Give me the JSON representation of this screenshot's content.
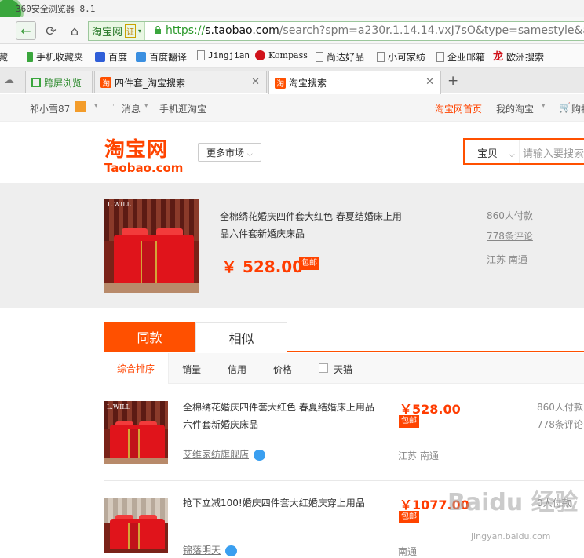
{
  "browser": {
    "title": "360安全浏览器 8.1",
    "site_badge": "淘宝网",
    "cert_label": "证",
    "url_scheme": "https://",
    "url_host": "s.taobao.com",
    "url_path": "/search?spm=a230r.1.14.14.vxJ7sO&type=samestyle&app="
  },
  "bookmarks": [
    {
      "label": "藏",
      "icon": "star-icon"
    },
    {
      "label": "手机收藏夹",
      "icon": "phone-icon"
    },
    {
      "label": "百度",
      "icon": "baidu-paw-icon"
    },
    {
      "label": "百度翻译",
      "icon": "translate-icon"
    },
    {
      "label": "Jingjian",
      "icon": "page-icon"
    },
    {
      "label": "Kompass",
      "icon": "kompass-icon"
    },
    {
      "label": "尚达好品",
      "icon": "page-icon"
    },
    {
      "label": "小可家纺",
      "icon": "page-icon"
    },
    {
      "label": "企业邮箱",
      "icon": "page-icon"
    },
    {
      "label": "欧洲搜索",
      "icon": "dragon-icon"
    }
  ],
  "tabs": [
    {
      "label": "跨屏浏览",
      "icon": "cross-screen-icon"
    },
    {
      "label": "四件套_淘宝搜索",
      "icon": "taobao-icon"
    },
    {
      "label": "淘宝搜索",
      "icon": "taobao-icon"
    }
  ],
  "topnav": {
    "user": "祁小雪87",
    "messages": "消息",
    "mobile": "手机逛淘宝",
    "home": "淘宝网首页",
    "my_taobao": "我的淘宝",
    "cart": "购物"
  },
  "header": {
    "logo_cn": "淘宝网",
    "logo_en": "Taobao.com",
    "more_markets": "更多市场",
    "search_category": "宝贝",
    "search_placeholder": "请输入要搜索"
  },
  "banner": {
    "brand": "L.WILL",
    "title": "全棉绣花婚庆四件套大红色 春夏结婚床上用品六件套新婚庆床品",
    "price": "￥ 528.00",
    "baoyou": "包邮",
    "sales": "860人付款",
    "reviews": "778条评论",
    "location": "江苏 南通"
  },
  "main_tabs": {
    "same": "同款",
    "similar": "相似"
  },
  "sort": {
    "default": "综合排序",
    "sales": "销量",
    "credit": "信用",
    "price": "价格",
    "tmall": "天猫"
  },
  "results": [
    {
      "brand": "L.WILL",
      "title": "全棉绣花婚庆四件套大红色 春夏结婚床上用品六件套新婚庆床品",
      "price": "￥528.00",
      "baoyou": "包邮",
      "sales": "860人付款",
      "reviews": "778条评论",
      "shop": "艾维家纺旗舰店",
      "location": "江苏 南通"
    },
    {
      "brand": "",
      "title": "抢下立减100!婚庆四件套大红婚庆穿上用品",
      "price": "￥1077.00",
      "baoyou": "包邮",
      "sales": "0人付款",
      "shop": "锦落明天",
      "location": "南通"
    }
  ],
  "watermark": {
    "logo": "Baidu 经验",
    "sub": "jingyan.baidu.com"
  },
  "colors": {
    "taobao_orange": "#ff5000",
    "price_red": "#ff3c00",
    "browser_green": "#3aa63d"
  }
}
